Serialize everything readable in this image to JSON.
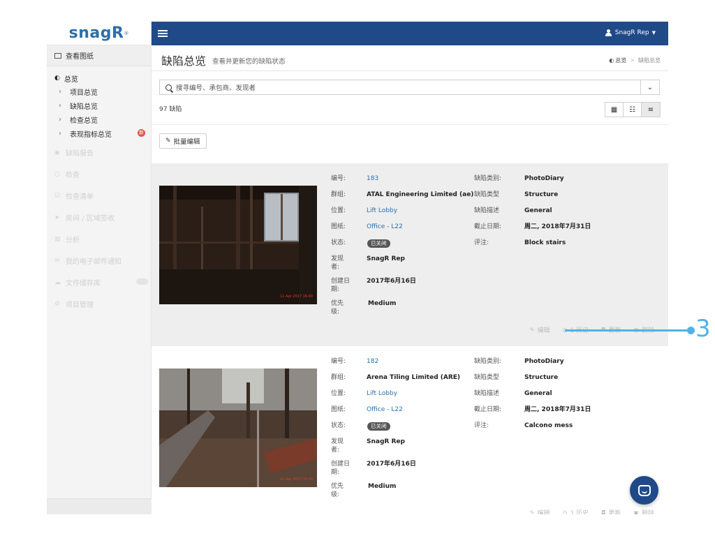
{
  "app": {
    "logo": "snagR",
    "logo_mark": "®"
  },
  "sidebar": {
    "top_item": "查看图纸",
    "group_title": "总览",
    "sub_items": [
      "项目总览",
      "缺陷总览",
      "检查总览",
      "表现指标总览"
    ],
    "sub_badge": "新",
    "dim_items": [
      {
        "label": "缺陷报告",
        "icon": "pin-icon"
      },
      {
        "label": "检查",
        "icon": "search-icon"
      },
      {
        "label": "检查清单",
        "icon": "checklist-icon"
      },
      {
        "label": "房间 / 区域签收",
        "icon": "send-icon"
      },
      {
        "label": "分析",
        "icon": "bar-chart-icon"
      },
      {
        "label": "我的电子邮件通知",
        "icon": "mail-icon"
      },
      {
        "label": "文件储存库",
        "icon": "cloud-icon"
      },
      {
        "label": "项目管理",
        "icon": "gears-icon"
      }
    ]
  },
  "topbar": {
    "user": "SnagR Rep"
  },
  "header": {
    "title": "缺陷总览",
    "subtitle": "查看并更新您的缺陷状态",
    "breadcrumb": [
      "总览",
      "缺陷总览"
    ]
  },
  "search": {
    "placeholder": "搜寻编号、承包商、发现者"
  },
  "list": {
    "count_text": "97 缺陷",
    "bulk_edit": "批量编辑"
  },
  "labels": {
    "id": "编号:",
    "group": "群组:",
    "location": "位置:",
    "drawing": "图纸:",
    "status": "状态:",
    "finder": "发现者:",
    "created": "创建日期:",
    "priority": "优先级:",
    "category": "缺陷类别:",
    "type": "缺陷类型",
    "desc": "缺陷描述",
    "due": "截止日期:",
    "comment": "评注:"
  },
  "actions": {
    "edit": "编辑",
    "history": "1 历史",
    "update": "更新",
    "delete": "删除"
  },
  "defects": [
    {
      "id": "183",
      "group": "ATAL Engineering Limited  (ae)",
      "location": "Lift Lobby",
      "drawing": "Office - L22",
      "status": "已关闭",
      "finder": "SnagR Rep",
      "created": "2017年6月16日",
      "priority": "Medium",
      "category": "PhotoDiary",
      "type": "Structure",
      "desc": "General",
      "due": "周二, 2018年7月31日",
      "comment": "Block stairs",
      "photo_stamp": "11 Apr 2017 16:40"
    },
    {
      "id": "182",
      "group": "Arena Tiling Limited  (ARE)",
      "location": "Lift Lobby",
      "drawing": "Office - L22",
      "status": "已关闭",
      "finder": "SnagR Rep",
      "created": "2017年6月16日",
      "priority": "Medium",
      "category": "PhotoDiary",
      "type": "Structure",
      "desc": "General",
      "due": "周二, 2018年7月31日",
      "comment": "Calcono mess",
      "photo_stamp": "11 Apr 2017 15:39"
    }
  ],
  "callout": {
    "number": "3"
  },
  "colors": {
    "nav": "#1f4a87",
    "link": "#2d6fa8",
    "callout": "#4fb3e8",
    "badge": "#e8514a"
  }
}
